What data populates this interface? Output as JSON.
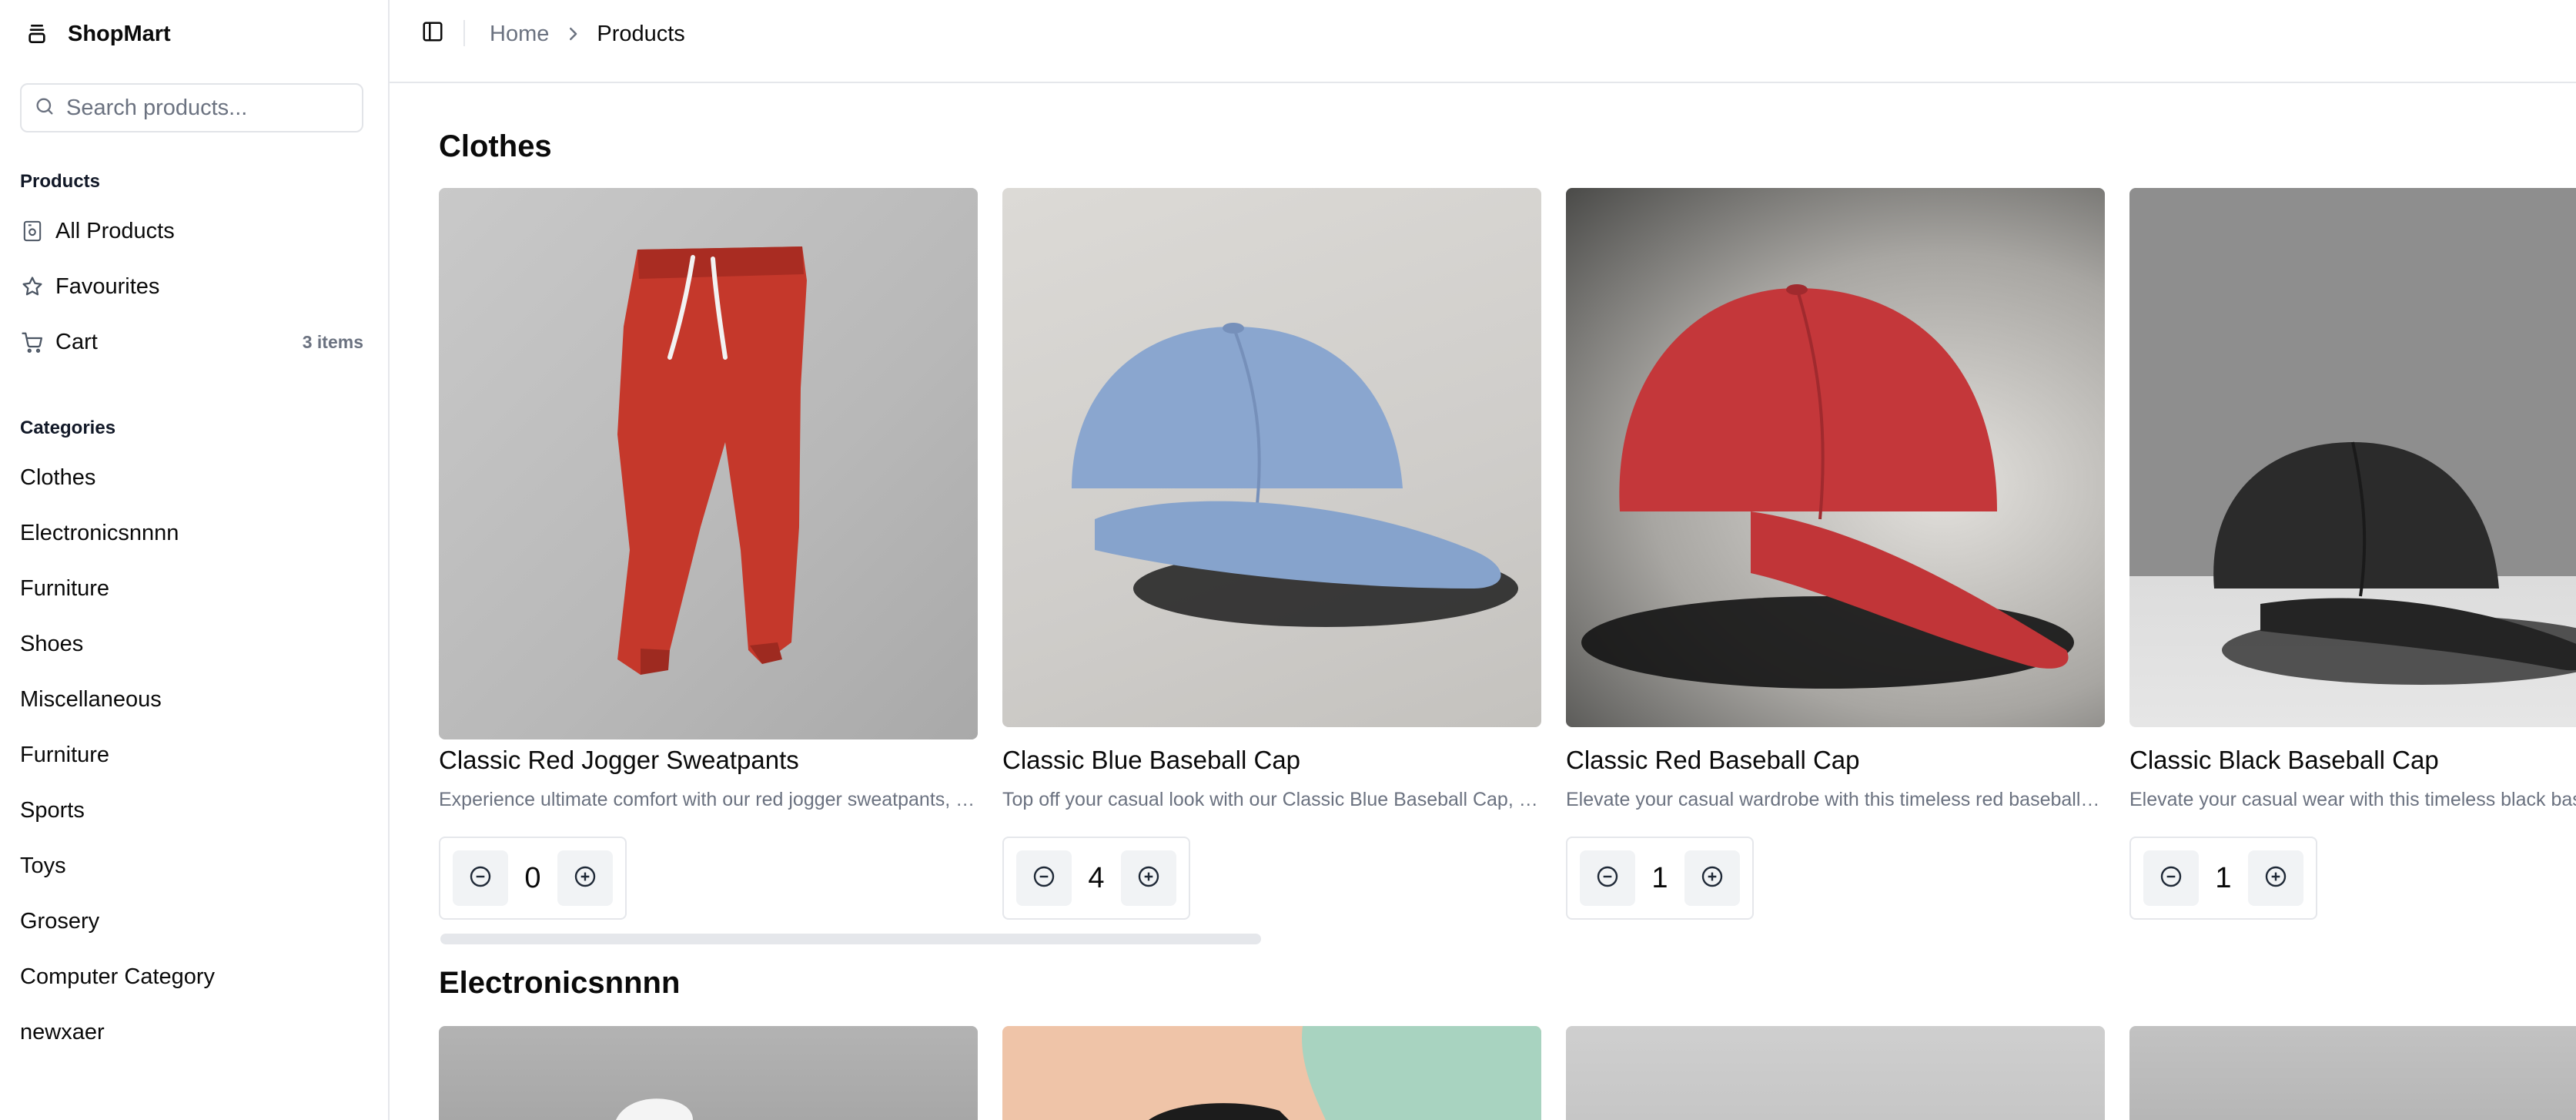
{
  "app": {
    "name": "ShopMart"
  },
  "search": {
    "placeholder": "Search products..."
  },
  "sidebar": {
    "products_label": "Products",
    "nav": [
      {
        "label": "All Products",
        "icon": "all-products-icon"
      },
      {
        "label": "Favourites",
        "icon": "star-icon"
      },
      {
        "label": "Cart",
        "icon": "cart-icon",
        "badge": "3 items"
      }
    ],
    "categories_label": "Categories",
    "categories": [
      "Clothes",
      "Electronicsnnnn",
      "Furniture",
      "Shoes",
      "Miscellaneous",
      "Furniture",
      "Sports",
      "Toys",
      "Grosery",
      "Computer Category",
      "newxaer"
    ]
  },
  "header": {
    "breadcrumb": {
      "home": "Home",
      "current": "Products"
    }
  },
  "sections": [
    {
      "title": "Clothes",
      "products": [
        {
          "name": "Classic Red Jogger Sweatpants",
          "description": "Experience ultimate comfort with our red jogger sweatpants, perfect for both workout sessions and lounging around the house.",
          "quantity": "0",
          "image": "red-jogger-sweatpants"
        },
        {
          "name": "Classic Blue Baseball Cap",
          "description": "Top off your casual look with our Classic Blue Baseball Cap, made from high-quality materials.",
          "quantity": "4",
          "image": "blue-baseball-cap"
        },
        {
          "name": "Classic Red Baseball Cap",
          "description": "Elevate your casual wardrobe with this timeless red baseball cap, crafted from durable fabric.",
          "quantity": "1",
          "image": "red-baseball-cap"
        },
        {
          "name": "Classic Black Baseball Cap",
          "description": "Elevate your casual wear with this timeless black baseball cap.",
          "quantity": "1",
          "image": "black-baseball-cap"
        }
      ]
    },
    {
      "title": "Electronicsnnnn",
      "products": [
        {
          "image": "electronics-product-1"
        },
        {
          "image": "electronics-product-2"
        },
        {
          "image": "electronics-product-3"
        },
        {
          "image": "electronics-product-4"
        }
      ]
    }
  ],
  "icons": {
    "brand": "store-icon",
    "search": "search-icon",
    "sidebar_toggle": "panel-left-icon",
    "breadcrumb_separator": "chevron-right-icon",
    "decrement": "minus-circle-icon",
    "increment": "plus-circle-icon"
  },
  "colors": {
    "muted_text": "#6b7280",
    "border": "#e5e7eb",
    "stepper_button_bg": "#f1f3f5"
  }
}
